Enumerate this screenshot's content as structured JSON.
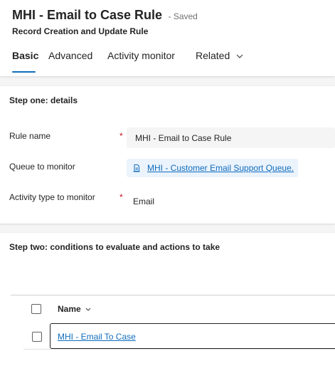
{
  "header": {
    "title": "MHI - Email to Case Rule",
    "status": "- Saved",
    "subtitle": "Record Creation and Update Rule",
    "tabs": [
      {
        "label": "Basic",
        "active": true
      },
      {
        "label": "Advanced",
        "active": false
      },
      {
        "label": "Activity monitor",
        "active": false
      },
      {
        "label": "Related",
        "active": false,
        "has_dropdown": true
      }
    ]
  },
  "step_one": {
    "title": "Step one: details",
    "rule_name": {
      "label": "Rule name",
      "required": "*",
      "value": "MHI - Email to Case Rule"
    },
    "queue": {
      "label": "Queue to monitor",
      "value": "MHI - Customer Email Support Queue.",
      "icon": "queue-icon"
    },
    "activity_type": {
      "label": "Activity type to monitor",
      "required": "*",
      "value": "Email"
    }
  },
  "step_two": {
    "title": "Step two: conditions to evaluate and actions to take",
    "grid": {
      "column_name": "Name",
      "rows": [
        {
          "name": "MHI - Email To Case"
        }
      ]
    }
  },
  "colors": {
    "accent": "#0f6cbd",
    "required": "#c50f1f",
    "text": "#242424"
  }
}
